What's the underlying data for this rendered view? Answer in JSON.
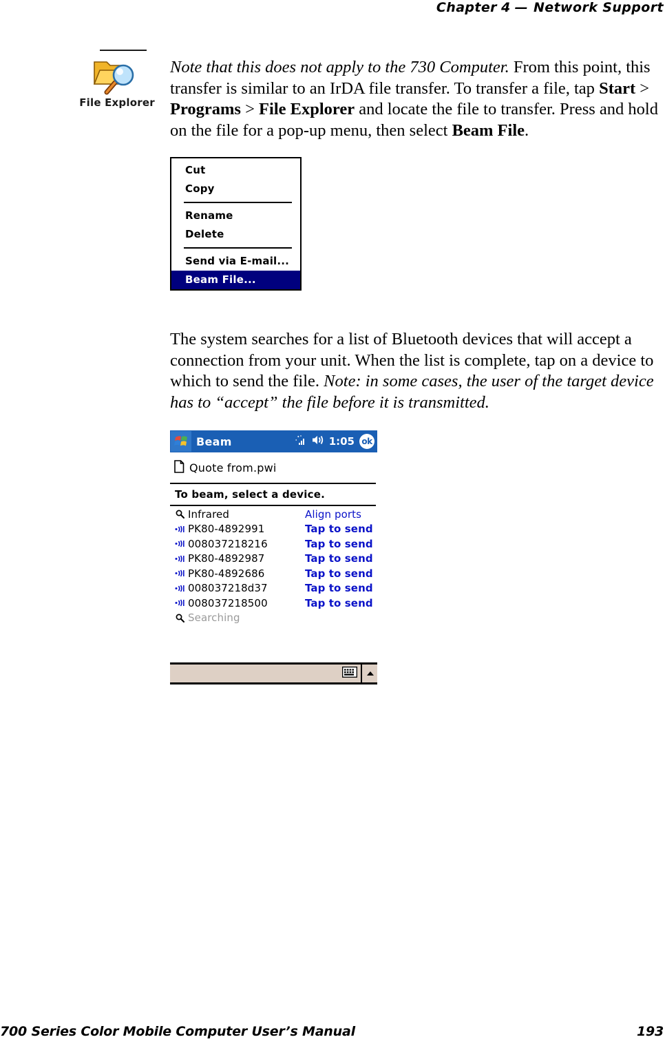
{
  "header": {
    "chapter_word": "Chapter",
    "chapter_number": "4",
    "dash": "—",
    "title": "Network Support"
  },
  "margin_note": {
    "icon": "file-explorer-icon",
    "label": "File Explorer"
  },
  "paragraphs": {
    "p1": {
      "italic_lead": "Note that this does not apply to the 730 Computer.",
      "t1": " From this point, this transfer is similar to an IrDA file transfer. To transfer a file, tap ",
      "b1": "Start",
      "t2": " > ",
      "b2": "Programs",
      "t3": " > ",
      "b3": "File Explorer",
      "t4": " and locate the file to transfer. Press and hold on the file for a pop-up menu, then select ",
      "b4": "Beam File",
      "t5": "."
    },
    "p2": {
      "t1": "The system searches for a list of Bluetooth devices that will accept a connection from your unit. When the list is complete, tap on a device to which to send the file. ",
      "italic_tail": "Note: in some cases, the user of the target device has to “accept” the file before it is transmitted."
    }
  },
  "context_menu": {
    "items": [
      {
        "label": "Cut",
        "selected": false
      },
      {
        "label": "Copy",
        "selected": false
      },
      {
        "label": "Rename",
        "selected": false
      },
      {
        "label": "Delete",
        "selected": false
      },
      {
        "label": "Send via E-mail...",
        "selected": false
      },
      {
        "label": "Beam File...",
        "selected": true
      }
    ],
    "highlight_color": "#00007e"
  },
  "pda": {
    "titlebar": {
      "app_title": "Beam",
      "logo": "windows-flag-icon",
      "connectivity_icon": "bluetooth-signal-icon",
      "volume_icon": "speaker-icon",
      "clock": "1:05",
      "ok_label": "ok",
      "bar_color": "#1a5fb4"
    },
    "file": {
      "icon": "document-icon",
      "name": "Quote from.pwi"
    },
    "prompt": "To beam, select a device.",
    "devices": [
      {
        "icon": "magnifier-icon",
        "name": "Infrared",
        "action": "Align ports",
        "state": "idle"
      },
      {
        "icon": "beam-wave-icon",
        "name": "PK80-4892991",
        "action": "Tap to send",
        "state": "ready"
      },
      {
        "icon": "beam-wave-icon",
        "name": "008037218216",
        "action": "Tap to send",
        "state": "ready"
      },
      {
        "icon": "beam-wave-icon",
        "name": "PK80-4892987",
        "action": "Tap to send",
        "state": "ready"
      },
      {
        "icon": "beam-wave-icon",
        "name": "PK80-4892686",
        "action": "Tap to send",
        "state": "ready"
      },
      {
        "icon": "beam-wave-icon",
        "name": "008037218d37",
        "action": "Tap to send",
        "state": "ready"
      },
      {
        "icon": "beam-wave-icon",
        "name": "008037218500",
        "action": "Tap to send",
        "state": "ready"
      },
      {
        "icon": "magnifier-icon",
        "name": "Searching",
        "action": "",
        "state": "searching"
      }
    ],
    "taskbar": {
      "keyboard_icon": "keyboard-icon",
      "expand_icon": "up-arrow-icon",
      "background_color": "#ded0c5"
    },
    "link_color": "#0a12c8"
  },
  "footer": {
    "manual_title": "700 Series Color Mobile Computer User’s Manual",
    "page_number": "193"
  }
}
